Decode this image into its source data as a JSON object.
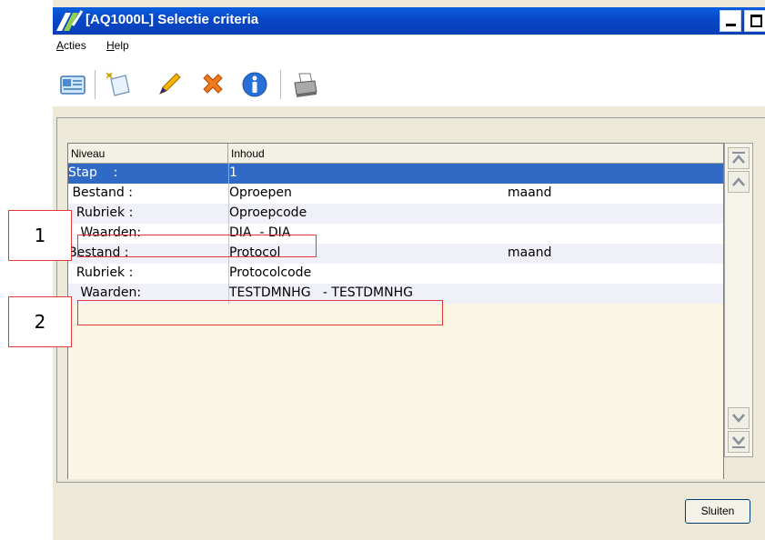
{
  "window": {
    "title": "[AQ1000L] Selectie criteria"
  },
  "menu": {
    "acties_first": "A",
    "acties_rest": "cties",
    "help_first": "H",
    "help_rest": "elp"
  },
  "toolbar": {
    "icons": [
      "card-icon",
      "new-document-icon",
      "pencil-icon",
      "delete-icon",
      "info-icon",
      "printer-icon"
    ]
  },
  "grid": {
    "columns": {
      "niveau": "Niveau",
      "inhoud": "Inhoud"
    },
    "rows": [
      {
        "niveau": "Stap    :",
        "inhoud": "1",
        "extra": ""
      },
      {
        "niveau": " Bestand :",
        "inhoud": "Oproepen",
        "extra": "maand"
      },
      {
        "niveau": "  Rubriek :",
        "inhoud": "Oproepcode",
        "extra": ""
      },
      {
        "niveau": "   Waarden:",
        "inhoud": "DIA  - DIA",
        "extra": ""
      },
      {
        "niveau": "Bestand :",
        "inhoud": "Protocol",
        "extra": "maand"
      },
      {
        "niveau": "  Rubriek :",
        "inhoud": "Protocolcode",
        "extra": ""
      },
      {
        "niveau": "   Waarden:",
        "inhoud": "TESTDMNHG   - TESTDMNHG",
        "extra": ""
      }
    ]
  },
  "buttons": {
    "close": "Sluiten"
  },
  "annotations": {
    "callout_1": "1",
    "callout_2": "2"
  },
  "colors": {
    "titlebar": "#0a5fe0",
    "selection": "#316ac5",
    "highlight": "#e23a3a",
    "grid_bg": "#fbf5e4"
  }
}
